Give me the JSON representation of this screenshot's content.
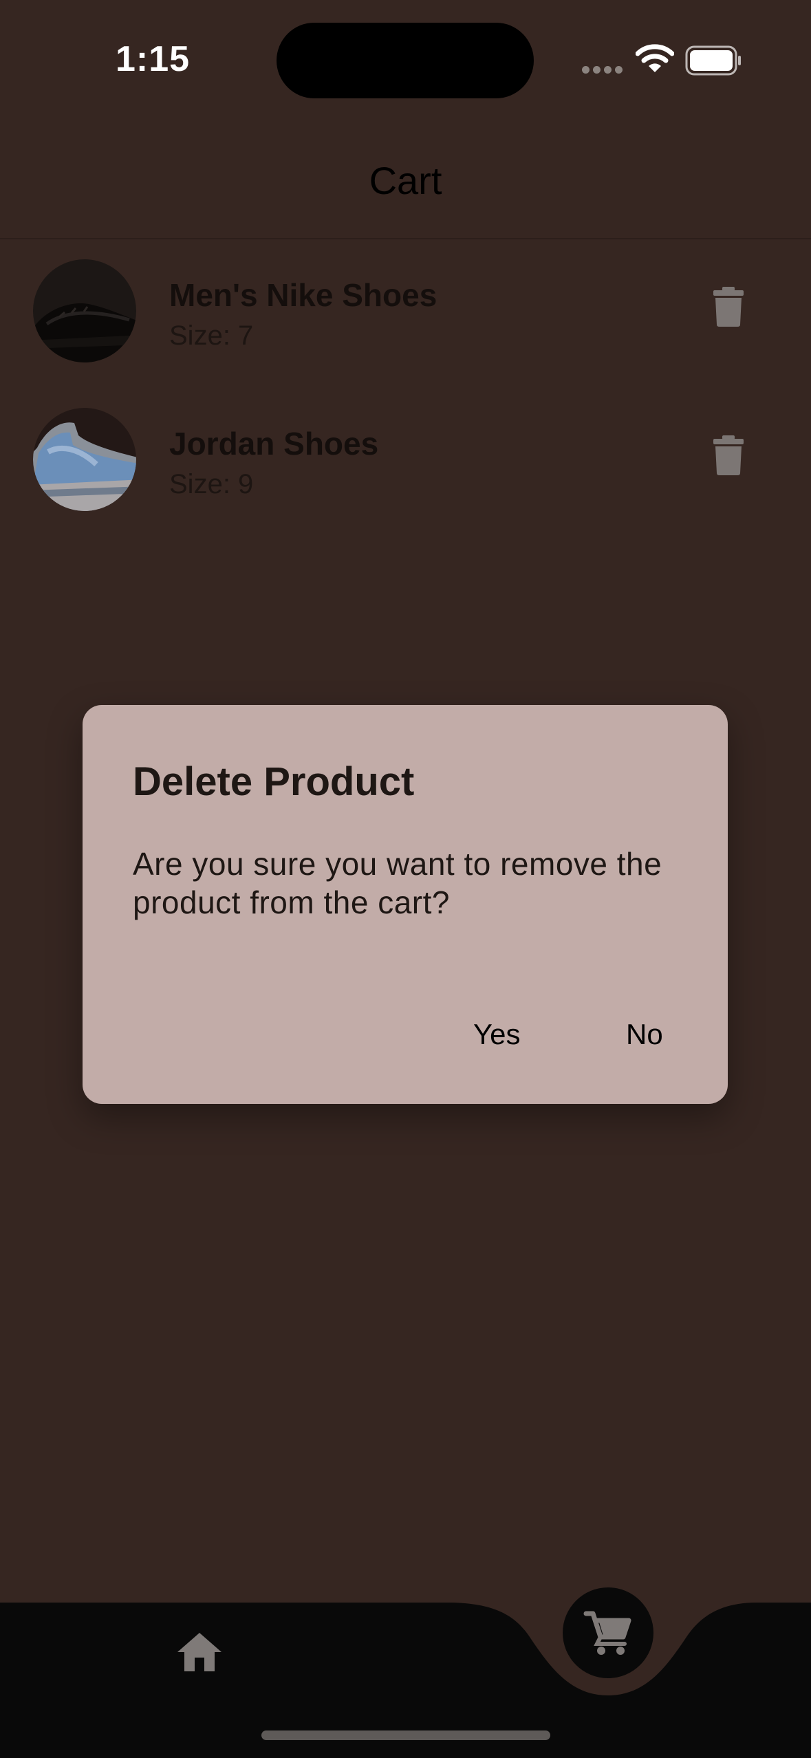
{
  "status_bar": {
    "time": "1:15"
  },
  "header": {
    "title": "Cart"
  },
  "cart": {
    "items": [
      {
        "name": "Men's Nike Shoes",
        "size": "Size: 7"
      },
      {
        "name": "Jordan Shoes",
        "size": "Size: 9"
      }
    ]
  },
  "dialog": {
    "title": "Delete Product",
    "message": "Are you sure you want to remove the product from the cart?",
    "yes_label": "Yes",
    "no_label": "No"
  },
  "bottom_nav": {
    "items": [
      {
        "icon": "home-icon"
      },
      {
        "icon": "shopping-cart-icon",
        "active": true
      }
    ]
  },
  "colors": {
    "background": "#362621",
    "dialog": "#c2aca8",
    "nav_bar": "#090909"
  }
}
